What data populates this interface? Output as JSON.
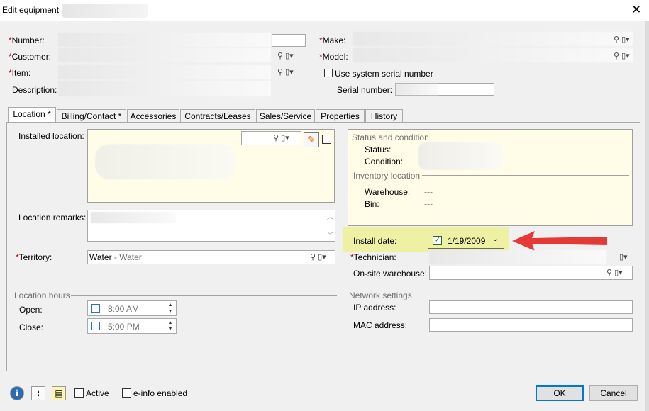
{
  "window": {
    "title": "Edit equipment",
    "close_glyph": "✕"
  },
  "header": {
    "number_label": "Number:",
    "customer_label": "Customer:",
    "item_label": "Item:",
    "description_label": "Description:",
    "make_label": "Make:",
    "model_label": "Model:",
    "use_serial_label": "Use system serial number",
    "serial_label": "Serial number:",
    "required_mark": "*"
  },
  "tabs": [
    {
      "label": "Location *"
    },
    {
      "label": "Billing/Contact *"
    },
    {
      "label": "Accessories"
    },
    {
      "label": "Contracts/Leases"
    },
    {
      "label": "Sales/Service"
    },
    {
      "label": "Properties"
    },
    {
      "label": "History"
    }
  ],
  "location": {
    "installed_location_label": "Installed location:",
    "location_remarks_label": "Location remarks:",
    "territory_label": "Territory:",
    "territory_value": "Water",
    "territory_desc": "- Water",
    "location_hours_label": "Location hours",
    "open_label": "Open:",
    "open_value": "8:00 AM",
    "close_label": "Close:",
    "close_value": "5:00 PM"
  },
  "status": {
    "group_label": "Status and condition",
    "status_label": "Status:",
    "condition_label": "Condition:",
    "inventory_label": "Inventory location",
    "warehouse_label": "Warehouse:",
    "warehouse_value": "---",
    "bin_label": "Bin:",
    "bin_value": "---"
  },
  "install": {
    "label": "Install date:",
    "value": "1/19/2009",
    "checked": true
  },
  "technician": {
    "label": "Technician:",
    "onsite_label": "On-site warehouse:"
  },
  "network": {
    "group_label": "Network settings",
    "ip_label": "IP address:",
    "mac_label": "MAC address:"
  },
  "footer": {
    "active_label": "Active",
    "einfo_label": "e-info enabled",
    "ok_label": "OK",
    "cancel_label": "Cancel"
  },
  "icons": [
    "info-icon",
    "paperclip-icon",
    "notes-icon",
    "search-icon",
    "lookup-dropdown-icon",
    "pencil-icon",
    "arrow-icon"
  ],
  "colors": {
    "highlight": "#eef0a4",
    "arrow": "#e53935",
    "required": "#c00000",
    "ok_border": "#0078d7"
  }
}
